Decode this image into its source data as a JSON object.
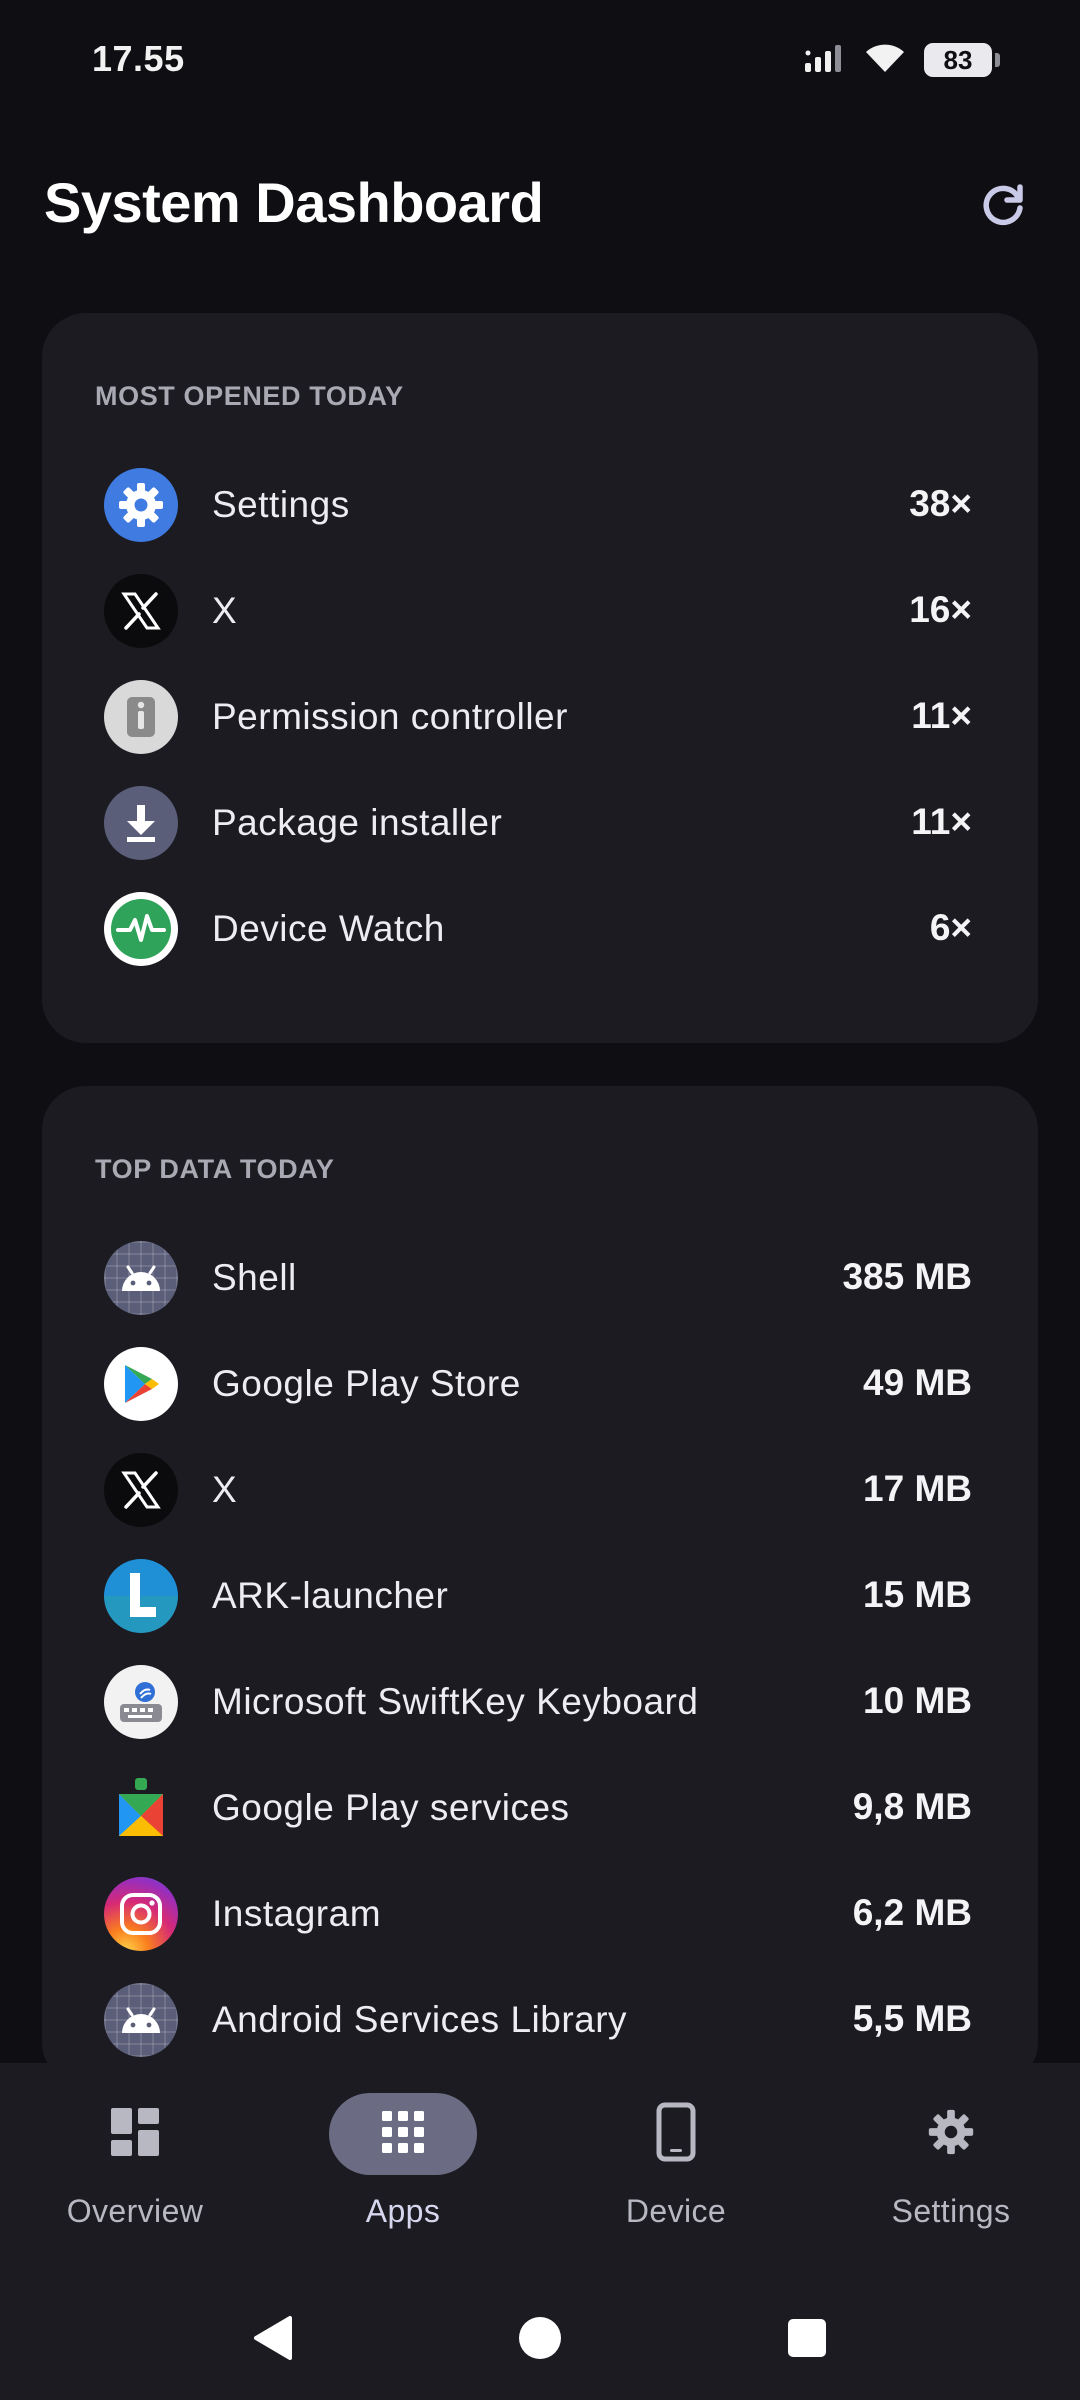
{
  "status_bar": {
    "time": "17.55",
    "battery": "83"
  },
  "header": {
    "title": "System Dashboard",
    "refresh_icon": "refresh-icon"
  },
  "most_opened": {
    "title": "MOST OPENED TODAY",
    "items": [
      {
        "name": "Settings",
        "value": "38×",
        "icon": "settings-gear"
      },
      {
        "name": "X",
        "value": "16×",
        "icon": "x-logo"
      },
      {
        "name": "Permission controller",
        "value": "11×",
        "icon": "permission-controller"
      },
      {
        "name": "Package installer",
        "value": "11×",
        "icon": "download-arrow"
      },
      {
        "name": "Device Watch",
        "value": "6×",
        "icon": "device-watch-pulse"
      }
    ]
  },
  "top_data": {
    "title": "TOP DATA TODAY",
    "items": [
      {
        "name": "Shell",
        "value": "385 MB",
        "icon": "android-robot"
      },
      {
        "name": "Google Play Store",
        "value": "49 MB",
        "icon": "play-store"
      },
      {
        "name": "X",
        "value": "17 MB",
        "icon": "x-logo"
      },
      {
        "name": "ARK-launcher",
        "value": "15 MB",
        "icon": "ark-launcher-l"
      },
      {
        "name": "Microsoft SwiftKey Keyboard",
        "value": "10 MB",
        "icon": "swiftkey-keyboard"
      },
      {
        "name": "Google Play services",
        "value": "9,8 MB",
        "icon": "play-services"
      },
      {
        "name": "Instagram",
        "value": "6,2 MB",
        "icon": "instagram-camera"
      },
      {
        "name": "Android Services Library",
        "value": "5,5 MB",
        "icon": "android-robot"
      }
    ]
  },
  "bottom_nav": {
    "active": "Apps",
    "items": [
      {
        "label": "Overview",
        "icon": "dashboard-grid"
      },
      {
        "label": "Apps",
        "icon": "apps-grid"
      },
      {
        "label": "Device",
        "icon": "phone"
      },
      {
        "label": "Settings",
        "icon": "settings-gear"
      }
    ]
  },
  "system_nav": {
    "items": [
      "back",
      "home",
      "recents"
    ]
  },
  "colors": {
    "background": "#0f0f13",
    "card": "#1b1b21",
    "section_title": "#a9a9b3",
    "active_nav_pill": "#6b6b84",
    "settings_blue": "#3f7be0",
    "device_watch_green": "#2fa35a",
    "package_installer": "#5b5e79"
  }
}
